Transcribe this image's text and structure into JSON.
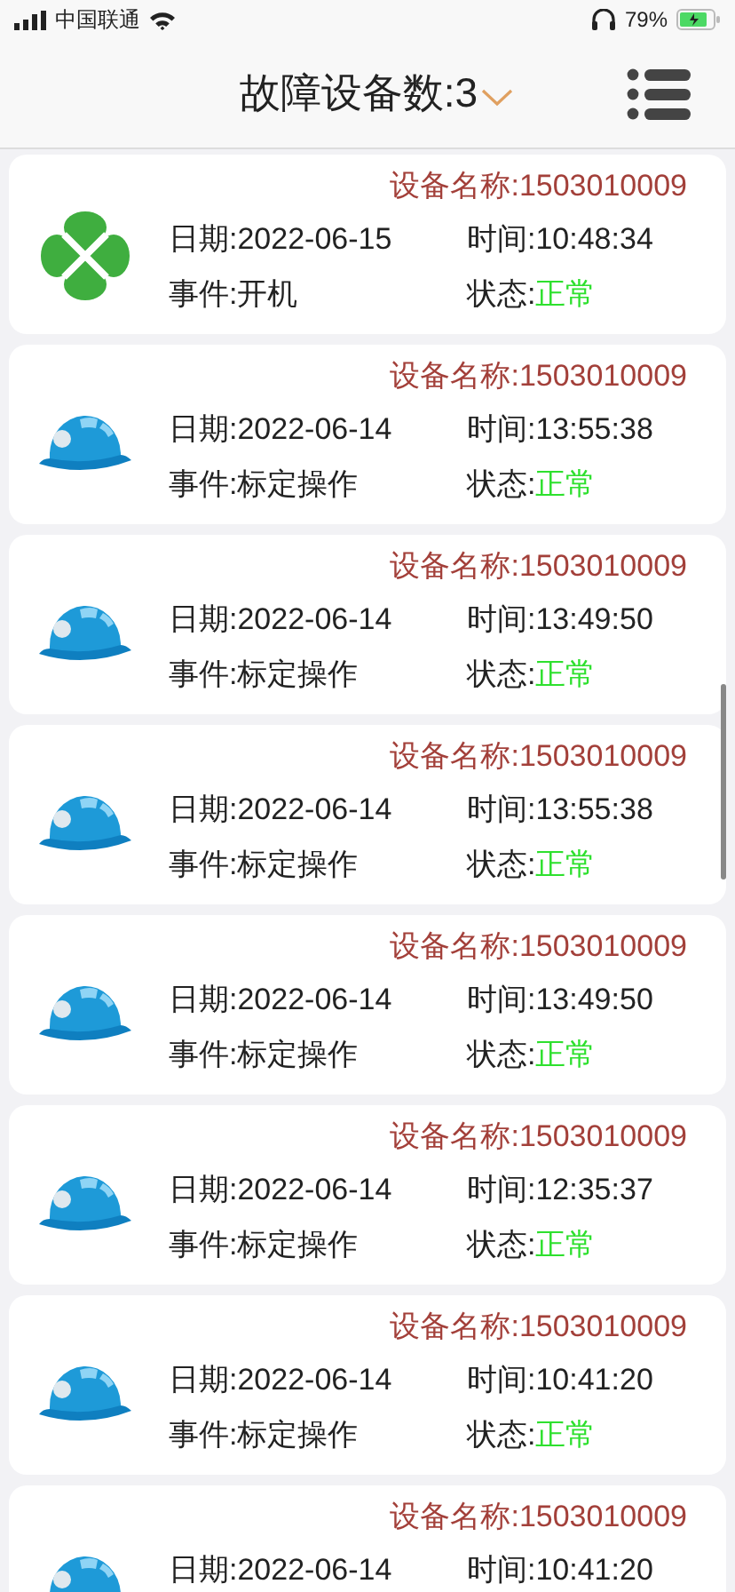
{
  "status_bar": {
    "carrier": "中国联通",
    "battery": "79%"
  },
  "header": {
    "title": "故障设备数:3"
  },
  "records": [
    {
      "kind": "clover",
      "device": "设备名称:1503010009",
      "date": "日期:2022-06-15",
      "time": "时间:10:48:34",
      "event": "事件:开机",
      "status_label": "状态:",
      "status": "正常"
    },
    {
      "kind": "helmet",
      "device": "设备名称:1503010009",
      "date": "日期:2022-06-14",
      "time": "时间:13:55:38",
      "event": "事件:标定操作",
      "status_label": "状态:",
      "status": "正常"
    },
    {
      "kind": "helmet",
      "device": "设备名称:1503010009",
      "date": "日期:2022-06-14",
      "time": "时间:13:49:50",
      "event": "事件:标定操作",
      "status_label": "状态:",
      "status": "正常"
    },
    {
      "kind": "helmet",
      "device": "设备名称:1503010009",
      "date": "日期:2022-06-14",
      "time": "时间:13:55:38",
      "event": "事件:标定操作",
      "status_label": "状态:",
      "status": "正常"
    },
    {
      "kind": "helmet",
      "device": "设备名称:1503010009",
      "date": "日期:2022-06-14",
      "time": "时间:13:49:50",
      "event": "事件:标定操作",
      "status_label": "状态:",
      "status": "正常"
    },
    {
      "kind": "helmet",
      "device": "设备名称:1503010009",
      "date": "日期:2022-06-14",
      "time": "时间:12:35:37",
      "event": "事件:标定操作",
      "status_label": "状态:",
      "status": "正常"
    },
    {
      "kind": "helmet",
      "device": "设备名称:1503010009",
      "date": "日期:2022-06-14",
      "time": "时间:10:41:20",
      "event": "事件:标定操作",
      "status_label": "状态:",
      "status": "正常"
    },
    {
      "kind": "helmet",
      "device": "设备名称:1503010009",
      "date": "日期:2022-06-14",
      "time": "时间:10:41:20"
    }
  ]
}
